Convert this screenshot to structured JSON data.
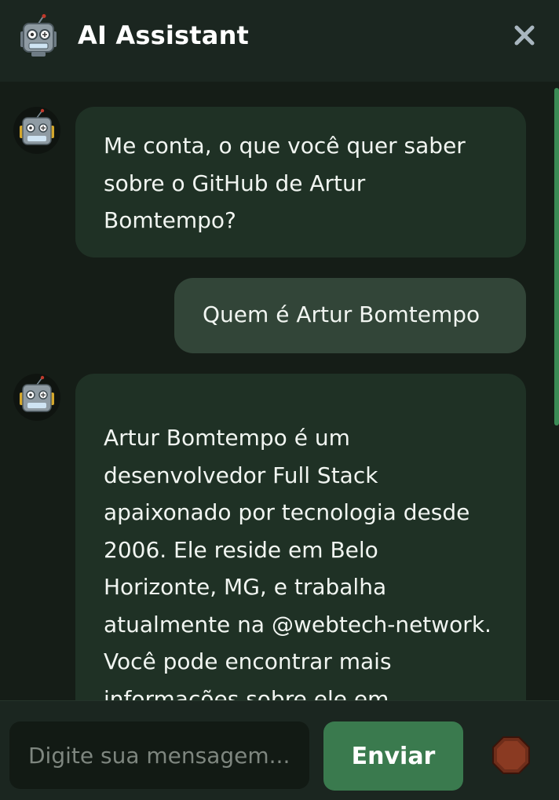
{
  "header": {
    "title": "AI Assistant",
    "logo_icon": "robot-icon",
    "close_icon": "close-icon"
  },
  "messages": [
    {
      "role": "assistant",
      "text": "Me conta, o que você quer saber sobre o GitHub de Artur Bomtempo?"
    },
    {
      "role": "user",
      "text": "Quem é Artur Bomtempo"
    },
    {
      "role": "assistant",
      "text": "Artur Bomtempo é um desenvolvedor Full Stack apaixonado por tecnologia desde 2006. Ele reside em Belo Horizonte, MG, e trabalha atualmente na @webtech-network. Você pode encontrar mais informações sobre ele em"
    }
  ],
  "composer": {
    "placeholder": "Digite sua mensagem...",
    "value": "",
    "send_label": "Enviar",
    "stop_icon": "stop-icon"
  },
  "colors": {
    "background": "#151d17",
    "header": "#1b2620",
    "assistant_bubble": "#1f3125",
    "user_bubble": "#324538",
    "accent": "#3a7a4e",
    "stop": "#7a2e1a"
  }
}
